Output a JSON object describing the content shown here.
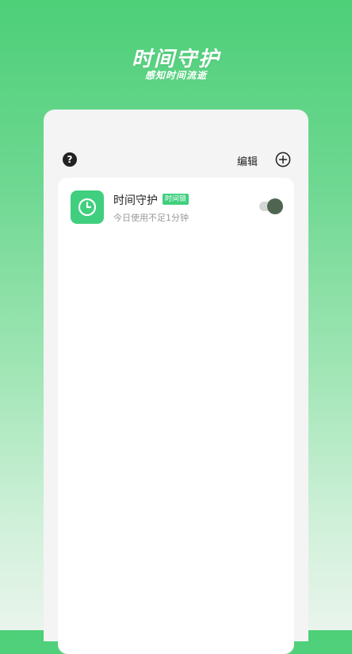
{
  "header": {
    "title": "时间守护",
    "subtitle": "感知时间流逝"
  },
  "toolbar": {
    "help_icon": "question-icon",
    "help_glyph": "?",
    "edit_label": "编辑",
    "add_icon": "plus-circle-icon"
  },
  "items": [
    {
      "icon": "clock-icon",
      "title": "时间守护",
      "tag": "时间锁",
      "subtitle": "今日使用不足1分钟",
      "toggle_on": true
    }
  ],
  "colors": {
    "accent": "#3fcf7e",
    "toggle_knob": "#506452",
    "toggle_track": "#d4d7d4"
  }
}
